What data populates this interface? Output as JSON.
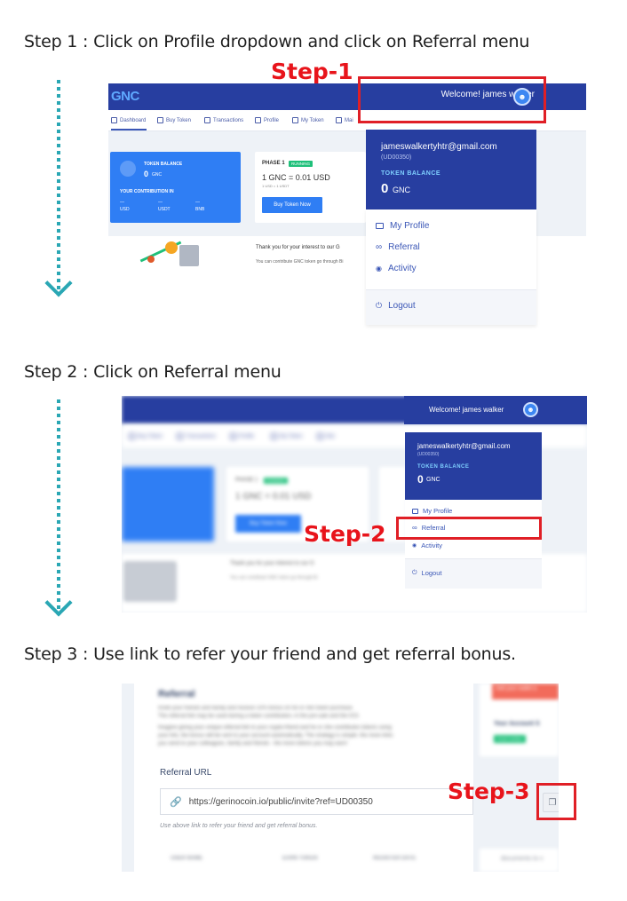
{
  "steps": [
    {
      "heading": "Step 1 : Click on Profile dropdown and click on Referral menu",
      "callout": "Step-1"
    },
    {
      "heading": "Step 2 : Click on Referral menu",
      "callout": "Step-2"
    },
    {
      "heading": "Step 3 : Use link to refer your friend and get referral bonus.",
      "callout": "Step-3"
    }
  ],
  "colors": {
    "accent_red": "#e01f26",
    "dotted_arrow": "#2aa7b4",
    "brand_navy": "#273ea0",
    "brand_blue": "#2f7ef4"
  },
  "app": {
    "logo": "GNC",
    "nav": [
      "Dashboard",
      "Buy Token",
      "Transactions",
      "Profile",
      "My Token",
      "Mai"
    ],
    "welcome": "Welcome! james walker",
    "token_card": {
      "title": "TOKEN BALANCE",
      "amount": "0",
      "unit": "GNC",
      "contribution_label": "YOUR CONTRIBUTION IN",
      "contrib": [
        {
          "value": "—",
          "currency": "USD"
        },
        {
          "value": "—",
          "currency": "USDT"
        },
        {
          "value": "—",
          "currency": "BNB"
        }
      ]
    },
    "phase_card": {
      "phase": "PHASE 1",
      "status": "RUNNING",
      "rate": "1 GNC = 0.01 USD",
      "sub_rate": "1 USD = 1 USDT",
      "buy_button": "Buy Token Now"
    },
    "intro_title": "Thank you for your interest to our G",
    "intro_text": "You can contribute GNC token go through Bi",
    "dropdown": {
      "email": "jameswalkertyhtr@gmail.com",
      "user_id": "(UD00350)",
      "balance_label": "TOKEN BALANCE",
      "balance_value": "0",
      "balance_unit": "GNC",
      "menu": [
        {
          "label": "My Profile",
          "icon": "id-card-icon"
        },
        {
          "label": "Referral",
          "icon": "infinity-icon"
        },
        {
          "label": "Activity",
          "icon": "eye-icon"
        }
      ],
      "logout": "Logout"
    }
  },
  "referral": {
    "title": "Referral",
    "intro": [
      "Invite your friends and family and receive 10% bonus on he or she token purchase.",
      "The referral link may be used during a token contribution, in the pre-sale and the ICO.",
      "Imagine giving your unique referral link to your crypto-friend and he or she contributes tokens using",
      "your link, the bonus will be sent to your account automatically. The strategy is simple: the more links",
      "you send to your colleagues, family and friends - the more tokens you may earn!"
    ],
    "url_label": "Referral URL",
    "url": "https://gerinocoin.io/public/invite?ref=UD00350",
    "hint": "Use above link to refer your friend and get referral bonus.",
    "table_headers": [
      "USER NAME",
      "EARN TOKEN",
      "REGISTER DATE"
    ],
    "side": {
      "wallet_banner": "Add your wallet a",
      "account_title": "Your Account S",
      "email_badge": "Email Verified",
      "documents_text": "documents to v"
    }
  }
}
